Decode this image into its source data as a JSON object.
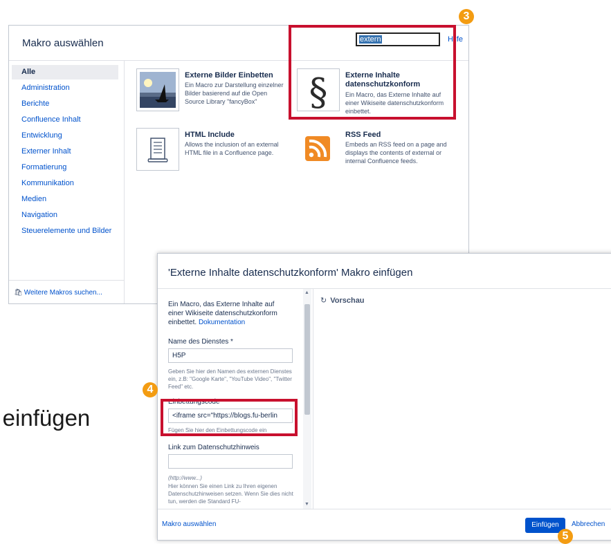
{
  "background": {
    "text": "k einfügen"
  },
  "macro_browser": {
    "title": "Makro auswählen",
    "search_value": "extern",
    "help_label": "Hilfe",
    "categories": [
      "Alle",
      "Administration",
      "Berichte",
      "Confluence Inhalt",
      "Entwicklung",
      "Externer Inhalt",
      "Formatierung",
      "Kommunikation",
      "Medien",
      "Navigation",
      "Steuerelemente und Bilder"
    ],
    "more_macros": "Weitere Makros suchen...",
    "macros": [
      {
        "title": "Externe Bilder Einbetten",
        "description": "Ein Macro zur Darstellung einzelner Bilder basierend auf die Open Source Library \"fancyBox\"",
        "icon": "image-icon"
      },
      {
        "title": "Externe Inhalte datenschutzkonform",
        "description": "Ein Macro, das Externe Inhalte auf einer Wikiseite datenschutzkonform einbettet.",
        "icon": "paragraph-icon"
      },
      {
        "title": "HTML Include",
        "description": "Allows the inclusion of an external HTML file in a Confluence page.",
        "icon": "scroll-icon"
      },
      {
        "title": "RSS Feed",
        "description": "Embeds an RSS feed on a page and displays the contents of external or internal Confluence feeds.",
        "icon": "rss-icon"
      }
    ]
  },
  "insert_dialog": {
    "title": "'Externe Inhalte datenschutzkonform' Makro einfügen",
    "intro": "Ein Macro, das Externe Inhalte auf einer Wikiseite datenschutzkonform einbettet.",
    "doc_link": "Dokumentation",
    "service_label": "Name des Dienstes *",
    "service_value": "H5P",
    "service_help": "Geben Sie hier den Namen des externen Dienstes ein, z.B: \"Google Karte\", \"YouTube Video\", \"Twitter Feed\" etc.",
    "embed_label": "Einbettungscode *",
    "embed_value": "<iframe src=\"https://blogs.fu-berlin",
    "embed_help": "Fügen Sie hier den Einbettungscode ein",
    "privacy_label": "Link zum Datenschutzhinweis",
    "privacy_value": "",
    "privacy_hint": "(http://www...)",
    "privacy_help": "Hier können Sie einen Link zu Ihren eigenen Datenschutzhinweisen setzen. Wenn Sie dies nicht tun, werden die Standard FU-",
    "preview_label": "Vorschau",
    "back_label": "Makro auswählen",
    "insert_label": "Einfügen",
    "cancel_label": "Abbrechen"
  },
  "markers": [
    "3",
    "4",
    "5"
  ],
  "colors": {
    "highlight": "#c8102e",
    "marker": "#f39c12",
    "primary": "#0052cc"
  }
}
